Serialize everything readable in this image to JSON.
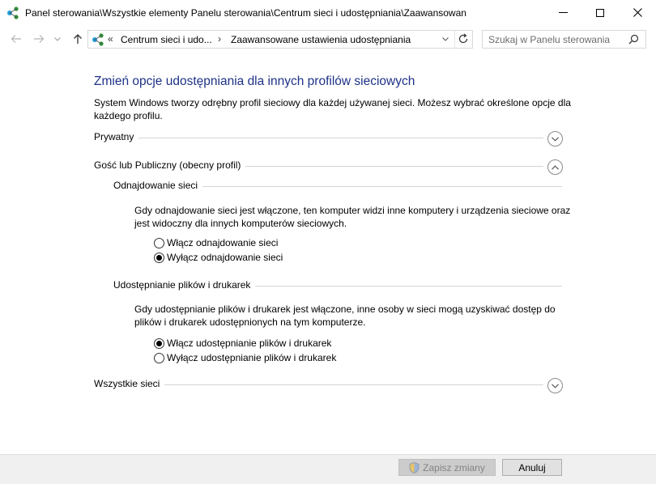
{
  "window": {
    "title": "Panel sterowania\\Wszystkie elementy Panelu sterowania\\Centrum sieci i udostępniania\\Zaawansowan"
  },
  "nav": {
    "breadcrumb_sep": "«",
    "crumb1": "Centrum sieci i udo...",
    "crumb_arrow": "›",
    "crumb2": "Zaawansowane ustawienia udostępniania",
    "search_placeholder": "Szukaj w Panelu sterowania"
  },
  "page": {
    "heading": "Zmień opcje udostępniania dla innych profilów sieciowych",
    "description": "System Windows tworzy odrębny profil sieciowy dla każdej używanej sieci. Możesz wybrać określone opcje dla każdego profilu."
  },
  "profiles": {
    "private": {
      "label": "Prywatny",
      "expanded": false
    },
    "guest": {
      "label": "Gość lub Publiczny (obecny profil)",
      "expanded": true
    },
    "all": {
      "label": "Wszystkie sieci",
      "expanded": false
    }
  },
  "discovery": {
    "title": "Odnajdowanie sieci",
    "text": "Gdy odnajdowanie sieci jest włączone, ten komputer widzi inne komputery i urządzenia sieciowe oraz jest widoczny dla innych komputerów sieciowych.",
    "on_label": "Włącz odnajdowanie sieci",
    "off_label": "Wyłącz odnajdowanie sieci",
    "selected": "off"
  },
  "sharing": {
    "title": "Udostępnianie plików i drukarek",
    "text": "Gdy udostępnianie plików i drukarek jest włączone, inne osoby w sieci mogą uzyskiwać dostęp do plików i drukarek udostępnionych na tym komputerze.",
    "on_label": "Włącz udostępnianie plików i drukarek",
    "off_label": "Wyłącz udostępnianie plików i drukarek",
    "selected": "on"
  },
  "footer": {
    "save_label": "Zapisz zmiany",
    "save_enabled": false,
    "cancel_label": "Anuluj"
  },
  "colors": {
    "heading": "#1e3287",
    "line": "#d4d4d4",
    "footer_bg": "#f0f0f0"
  }
}
